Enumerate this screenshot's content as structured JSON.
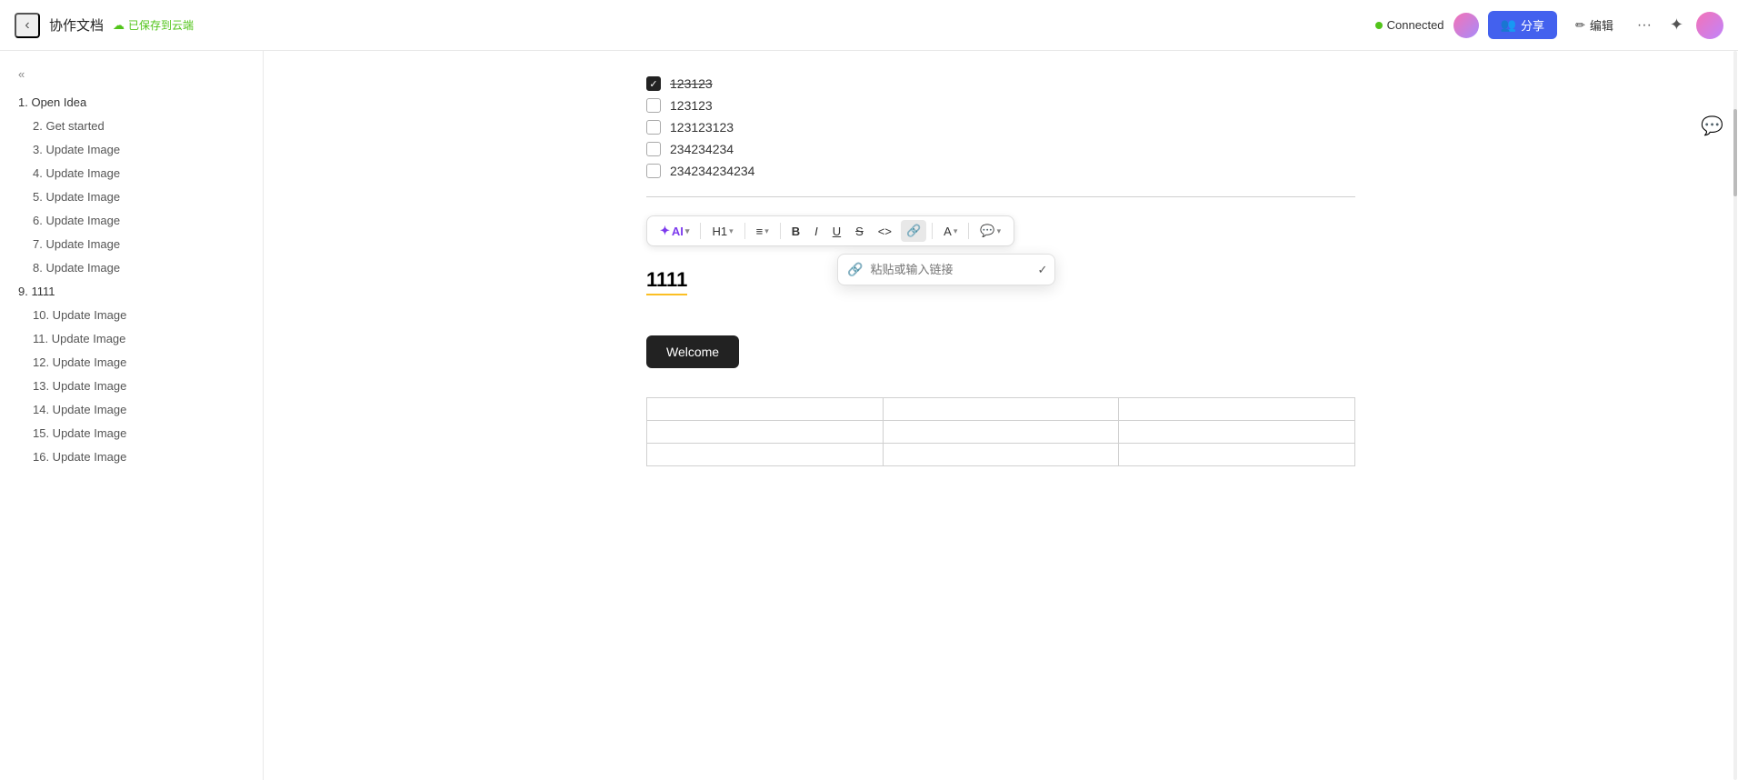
{
  "topbar": {
    "back_label": "‹",
    "doc_title": "协作文档",
    "save_status": "已保存到云端",
    "connected_label": "Connected",
    "share_label": "分享",
    "edit_label": "编辑",
    "more_label": "···"
  },
  "sidebar": {
    "collapse_label": "«",
    "items": [
      {
        "id": 1,
        "level": 1,
        "label": "1. Open Idea"
      },
      {
        "id": 2,
        "level": 2,
        "label": "2. Get started"
      },
      {
        "id": 3,
        "level": 2,
        "label": "3. Update Image"
      },
      {
        "id": 4,
        "level": 2,
        "label": "4. Update Image"
      },
      {
        "id": 5,
        "level": 2,
        "label": "5. Update Image"
      },
      {
        "id": 6,
        "level": 2,
        "label": "6. Update Image"
      },
      {
        "id": 7,
        "level": 2,
        "label": "7. Update Image"
      },
      {
        "id": 8,
        "level": 2,
        "label": "8. Update Image"
      },
      {
        "id": 9,
        "level": 1,
        "label": "9. 1111"
      },
      {
        "id": 10,
        "level": 2,
        "label": "10. Update Image"
      },
      {
        "id": 11,
        "level": 2,
        "label": "11. Update Image"
      },
      {
        "id": 12,
        "level": 2,
        "label": "12. Update Image"
      },
      {
        "id": 13,
        "level": 2,
        "label": "13. Update Image"
      },
      {
        "id": 14,
        "level": 2,
        "label": "14. Update Image"
      },
      {
        "id": 15,
        "level": 2,
        "label": "15. Update Image"
      },
      {
        "id": 16,
        "level": 2,
        "label": "16. Update Image"
      }
    ]
  },
  "content": {
    "checklist": [
      {
        "id": 1,
        "text": "123123",
        "checked": true
      },
      {
        "id": 2,
        "text": "123123",
        "checked": false
      },
      {
        "id": 3,
        "text": "123123123",
        "checked": false
      },
      {
        "id": 4,
        "text": "234234234",
        "checked": false
      },
      {
        "id": 5,
        "text": "234234234234",
        "checked": false
      }
    ],
    "heading": "1111",
    "welcome_btn": "Welcome",
    "link_placeholder": "粘贴或输入链接"
  },
  "toolbar": {
    "ai_label": "AI",
    "heading_label": "H1",
    "align_label": "≡",
    "bold_label": "B",
    "italic_label": "I",
    "underline_label": "U",
    "strike_label": "S",
    "code_label": "<>",
    "link_label": "🔗",
    "color_label": "A",
    "comment_label": "💬"
  }
}
